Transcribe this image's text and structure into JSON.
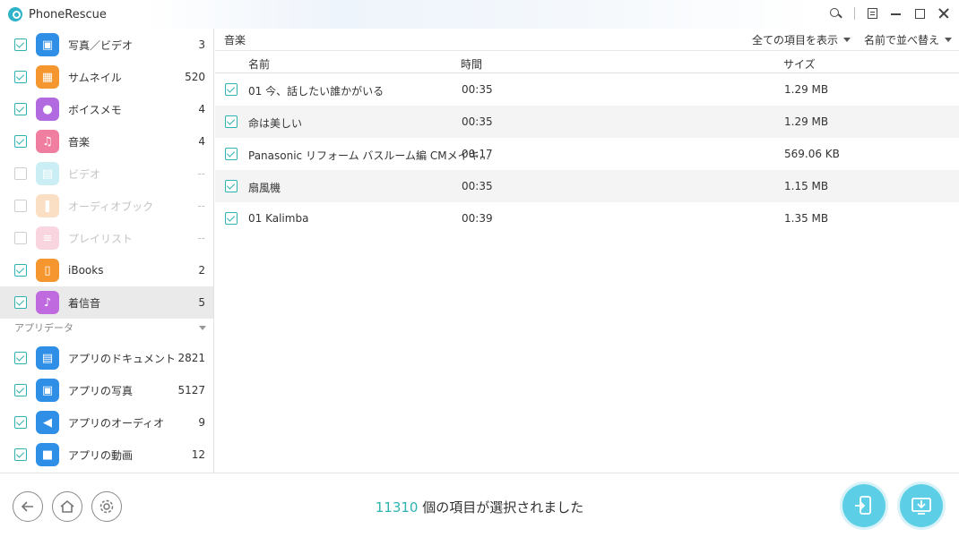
{
  "app": {
    "title": "PhoneRescue"
  },
  "sidebar": {
    "items": [
      {
        "label": "写真／ビデオ",
        "count": "3",
        "checked": true,
        "dim": false,
        "icon": "photo-video-icon",
        "color": "#2f8fe6"
      },
      {
        "label": "サムネイル",
        "count": "520",
        "checked": true,
        "dim": false,
        "icon": "thumbnail-icon",
        "color": "#f5962f"
      },
      {
        "label": "ボイスメモ",
        "count": "4",
        "checked": true,
        "dim": false,
        "icon": "microphone-icon",
        "color": "#b26ae0"
      },
      {
        "label": "音楽",
        "count": "4",
        "checked": true,
        "dim": false,
        "icon": "music-note-icon",
        "color": "#f07ea0"
      },
      {
        "label": "ビデオ",
        "count": "--",
        "checked": false,
        "dim": true,
        "icon": "clapper-icon",
        "color": "#6ad0df"
      },
      {
        "label": "オーディオブック",
        "count": "--",
        "checked": false,
        "dim": true,
        "icon": "audiobook-icon",
        "color": "#f5a65b"
      },
      {
        "label": "プレイリスト",
        "count": "--",
        "checked": false,
        "dim": true,
        "icon": "playlist-icon",
        "color": "#f08aa8"
      },
      {
        "label": "iBooks",
        "count": "2",
        "checked": true,
        "dim": false,
        "icon": "book-icon",
        "color": "#f5962f"
      },
      {
        "label": "着信音",
        "count": "5",
        "checked": true,
        "dim": false,
        "icon": "bell-icon",
        "color": "#c06ae0",
        "active": true
      }
    ],
    "section_label": "アプリデータ",
    "app_items": [
      {
        "label": "アプリのドキュメント",
        "count": "2821",
        "checked": true,
        "icon": "document-icon",
        "color": "#2f8fe6"
      },
      {
        "label": "アプリの写真",
        "count": "5127",
        "checked": true,
        "icon": "image-icon",
        "color": "#2f8fe6"
      },
      {
        "label": "アプリのオーディオ",
        "count": "9",
        "checked": true,
        "icon": "speaker-icon",
        "color": "#2f8fe6"
      },
      {
        "label": "アプリの動画",
        "count": "12",
        "checked": true,
        "icon": "video-camera-icon",
        "color": "#2f8fe6"
      }
    ]
  },
  "main": {
    "section_title": "音楽",
    "filter_label": "全ての項目を表示",
    "sort_label": "名前で並べ替え",
    "columns": {
      "name": "名前",
      "time": "時間",
      "size": "サイズ"
    },
    "rows": [
      {
        "name": "01 今、話したい誰かがいる",
        "time": "00:35",
        "size": "1.29 MB"
      },
      {
        "name": "命は美しい",
        "time": "00:35",
        "size": "1.29 MB"
      },
      {
        "name": "Panasonic リフォーム バスルーム編 CMメイキ...",
        "time": "00:17",
        "size": "569.06 KB"
      },
      {
        "name": "扇風機",
        "time": "00:35",
        "size": "1.15 MB"
      },
      {
        "name": "01 Kalimba",
        "time": "00:39",
        "size": "1.35 MB"
      }
    ]
  },
  "footer": {
    "selected_count": "11310",
    "selected_text": " 個の項目が選択されました"
  }
}
